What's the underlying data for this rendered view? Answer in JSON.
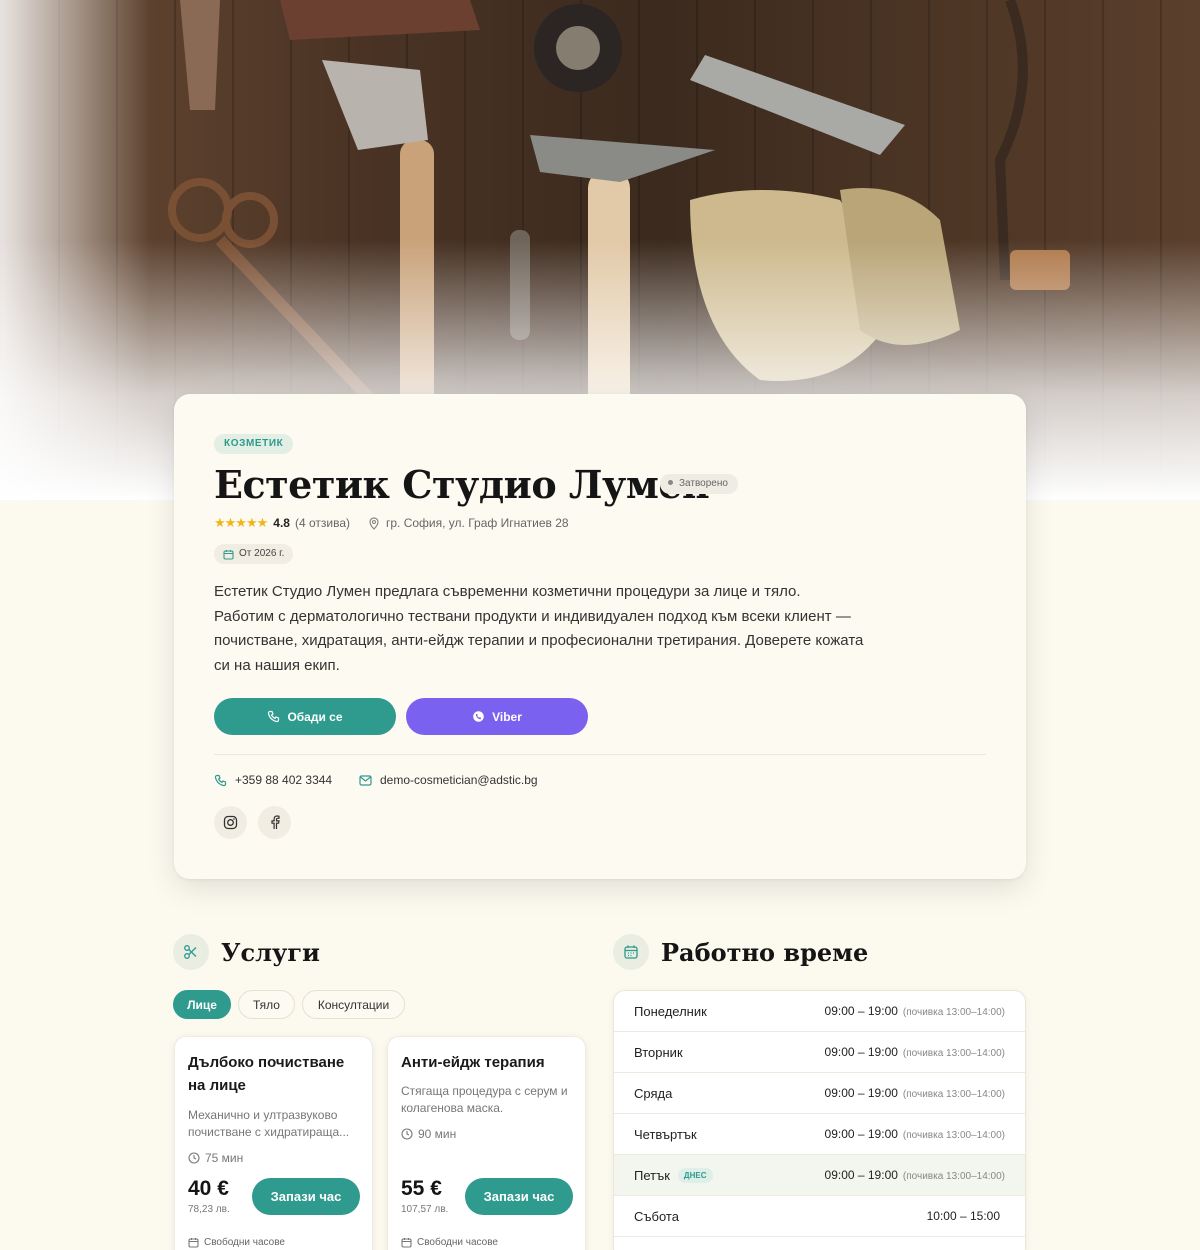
{
  "business": {
    "category": "КОЗМЕТИК",
    "name": "Естетик Студио Лумен",
    "status": "Затворено",
    "stars": "★★★★★",
    "rating": "4.8",
    "reviews": "(4 отзива)",
    "address": "гр. София, ул. Граф Игнатиев 28",
    "since": "От 2026 г.",
    "description": "Естетик Студио Лумен предлага съвременни козметични процедури за лице и тяло. Работим с дерматологично тествани продукти и индивидуален подход към всеки клиент — почистване, хидратация, анти-ейдж терапии и професионални третирания. Доверете кожата си на нашия екип.",
    "call_label": "Обади се",
    "viber_label": "Viber",
    "phone": "+359 88 402 3344",
    "email": "demo-cosmetician@adstic.bg"
  },
  "services": {
    "title": "Услуги",
    "tabs": [
      {
        "label": "Лице",
        "active": true
      },
      {
        "label": "Тяло",
        "active": false
      },
      {
        "label": "Консултации",
        "active": false
      }
    ],
    "items": [
      {
        "name": "Дълбоко почистване на лице",
        "description": "Механично и ултразвуково почистване с хидратираща...",
        "duration": "75 мин",
        "price": "40 €",
        "price_bgn": "78,23 лв.",
        "book_label": "Запази час",
        "slots_label": "Свободни часове"
      },
      {
        "name": "Анти-ейдж терапия",
        "description": "Стягаща процедура с серум и колагенова маска.",
        "duration": "90 мин",
        "price": "55 €",
        "price_bgn": "107,57 лв.",
        "book_label": "Запази час",
        "slots_label": "Свободни часове"
      }
    ]
  },
  "hours": {
    "title": "Работно време",
    "today_label": "ДНЕС",
    "days": [
      {
        "day": "Понеделник",
        "time": "09:00 – 19:00",
        "break": "(почивка 13:00–14:00)"
      },
      {
        "day": "Вторник",
        "time": "09:00 – 19:00",
        "break": "(почивка 13:00–14:00)"
      },
      {
        "day": "Сряда",
        "time": "09:00 – 19:00",
        "break": "(почивка 13:00–14:00)"
      },
      {
        "day": "Четвъртък",
        "time": "09:00 – 19:00",
        "break": "(почивка 13:00–14:00)"
      },
      {
        "day": "Петък",
        "time": "09:00 – 19:00",
        "break": "(почивка 13:00–14:00)",
        "today": true
      },
      {
        "day": "Събота",
        "time": "10:00 – 15:00",
        "break": ""
      }
    ]
  },
  "colors": {
    "accent": "#2f9a8e",
    "viber": "#7b61ef",
    "background": "#fcf9ef",
    "stars": "#f1b51c"
  }
}
